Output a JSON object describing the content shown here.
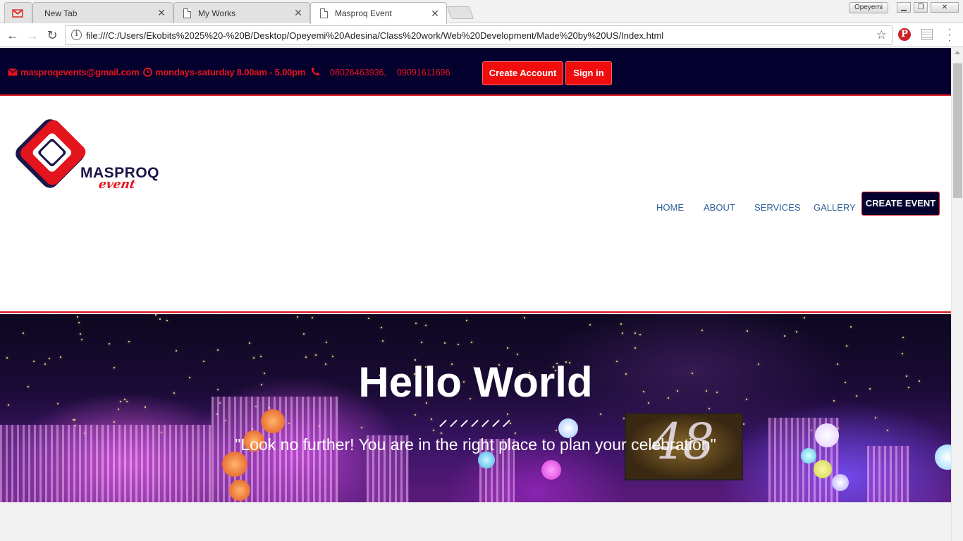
{
  "browser": {
    "tabs": [
      {
        "title": "",
        "icon": "gmail-icon"
      },
      {
        "title": "New Tab",
        "icon": "none"
      },
      {
        "title": "My Works",
        "icon": "document-icon"
      },
      {
        "title": "Masproq Event",
        "icon": "document-icon"
      }
    ],
    "profile_name": "Opeyemi",
    "url": "file:///C:/Users/Ekobits%2025%20-%20B/Desktop/Opeyemi%20Adesina/Class%20work/Web%20Development/Made%20by%20US/Index.html"
  },
  "topbar": {
    "email": "masproqevents@gmail.com",
    "hours": "mondays-saturday 8.00am - 5.00pm",
    "phone_1": "08026463936,",
    "phone_2": "09091611696",
    "create_account_label": "Create Account",
    "sign_in_label": "Sign in"
  },
  "logo": {
    "word": "MASPROQ",
    "sub": "event"
  },
  "nav": {
    "items": [
      {
        "label": "HOME"
      },
      {
        "label": "ABOUT"
      },
      {
        "label": "SERVICES"
      },
      {
        "label": "GALLERY"
      }
    ],
    "cta_label": "CREATE EVENT"
  },
  "hero": {
    "title": "Hello World",
    "quote": "\"Look no further! You are in the right place to plan your celebration\"",
    "screen_text": "48"
  },
  "colors": {
    "navy": "#04012e",
    "red": "#e4141d",
    "nav_link": "#2b5e96"
  }
}
